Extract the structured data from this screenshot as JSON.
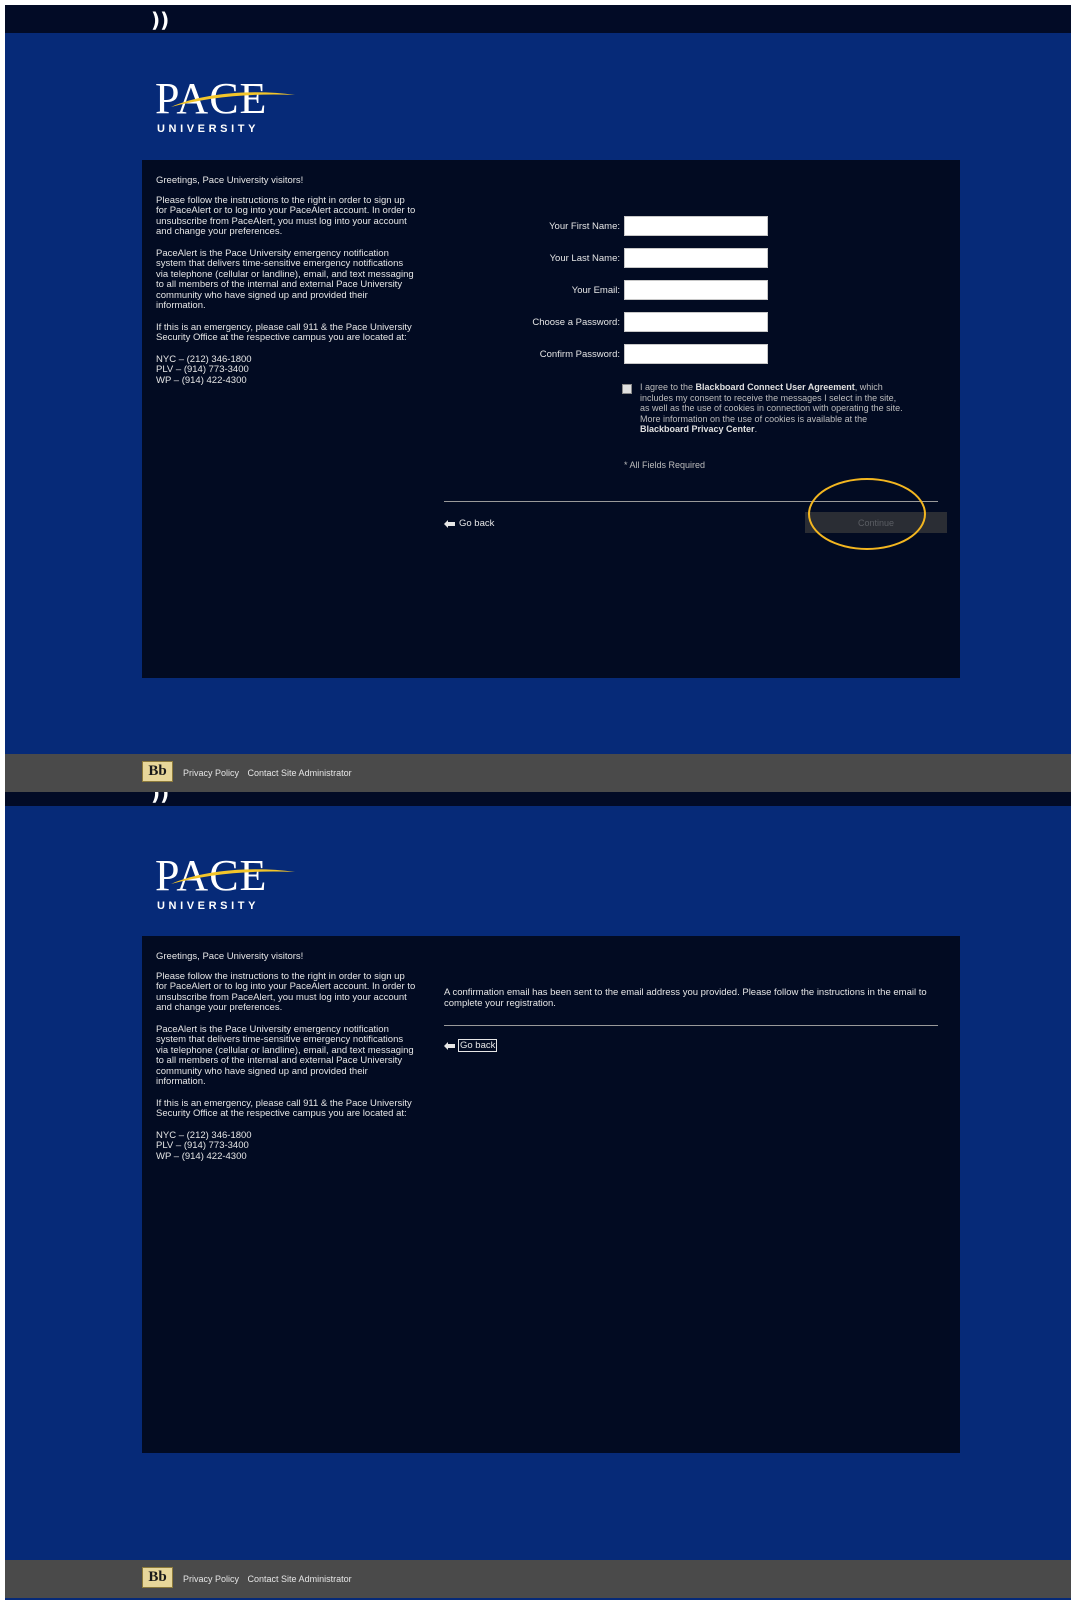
{
  "colors": {
    "page_bg": "#062a78",
    "panel_bg": "#020b22",
    "top_bar": "#020b26",
    "footer_bg": "#4a4a4a",
    "logo_swoosh": "#f3c52a",
    "highlight_ring": "#f3b620"
  },
  "header": {
    "glyph": "))"
  },
  "logo": {
    "wordmark": "PACE",
    "subtitle": "UNIVERSITY"
  },
  "info": {
    "greeting": "Greetings, Pace University visitors!",
    "instructions": "Please follow the instructions to the right in order to sign up for PaceAlert or to log into your PaceAlert account. In order to unsubscribe from PaceAlert, you must log into your account and change your preferences.",
    "description": "PaceAlert is the Pace University emergency notification system that delivers time-sensitive emergency notifications via telephone (cellular or landline), email, and text messaging to all members of the internal and external Pace University community who have signed up and provided their information.",
    "emergency": "If this is an emergency, please call 911 & the Pace University Security Office at the respective campus you are located at:",
    "phones": [
      "NYC – (212) 346-1800",
      "PLV – (914) 773-3400",
      "WP – (914) 422-4300"
    ]
  },
  "form": {
    "first_name_label": "Your First Name:",
    "last_name_label": "Your Last Name:",
    "email_label": "Your Email:",
    "password_label": "Choose a Password:",
    "confirm_label": "Confirm Password:",
    "first_name_value": "",
    "last_name_value": "",
    "email_value": "",
    "password_value": "",
    "confirm_value": "",
    "agree_prefix": "I agree to the ",
    "agree_link1": "Blackboard Connect User Agreement",
    "agree_middle": ", which includes my consent to receive the messages I select in the site, as well as the use of cookies in connection with operating the site. More information on the use of cookies is available at the ",
    "agree_link2": "Blackboard Privacy Center",
    "agree_suffix": ".",
    "agree_checked": false,
    "required_note": "* All Fields Required",
    "go_back": "Go back",
    "continue": "Continue"
  },
  "confirmation": {
    "message": "A confirmation email has been sent to the email address you provided. Please follow the instructions in the email to complete your registration.",
    "go_back": "Go back"
  },
  "footer": {
    "bb_logo": "Bb",
    "privacy": "Privacy Policy",
    "contact": "Contact Site Administrator"
  }
}
